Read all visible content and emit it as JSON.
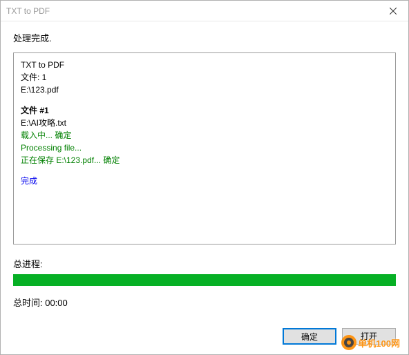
{
  "window": {
    "title": "TXT to PDF"
  },
  "status": "处理完成.",
  "log": {
    "header1": "TXT to PDF",
    "header2": "文件: 1",
    "header3": "E:\\123.pdf",
    "file_header": "文件 #1",
    "file_path": "E:\\AI攻略.txt",
    "loading": "载入中... 确定",
    "processing": "Processing file...",
    "saving": "正在保存 E:\\123.pdf... 确定",
    "done": "完成"
  },
  "progress": {
    "label": "总进程:",
    "percent": 100
  },
  "time": {
    "label": "总时间: 00:00"
  },
  "buttons": {
    "ok": "确定",
    "open": "打开"
  },
  "watermark": {
    "text": "单机100网"
  }
}
